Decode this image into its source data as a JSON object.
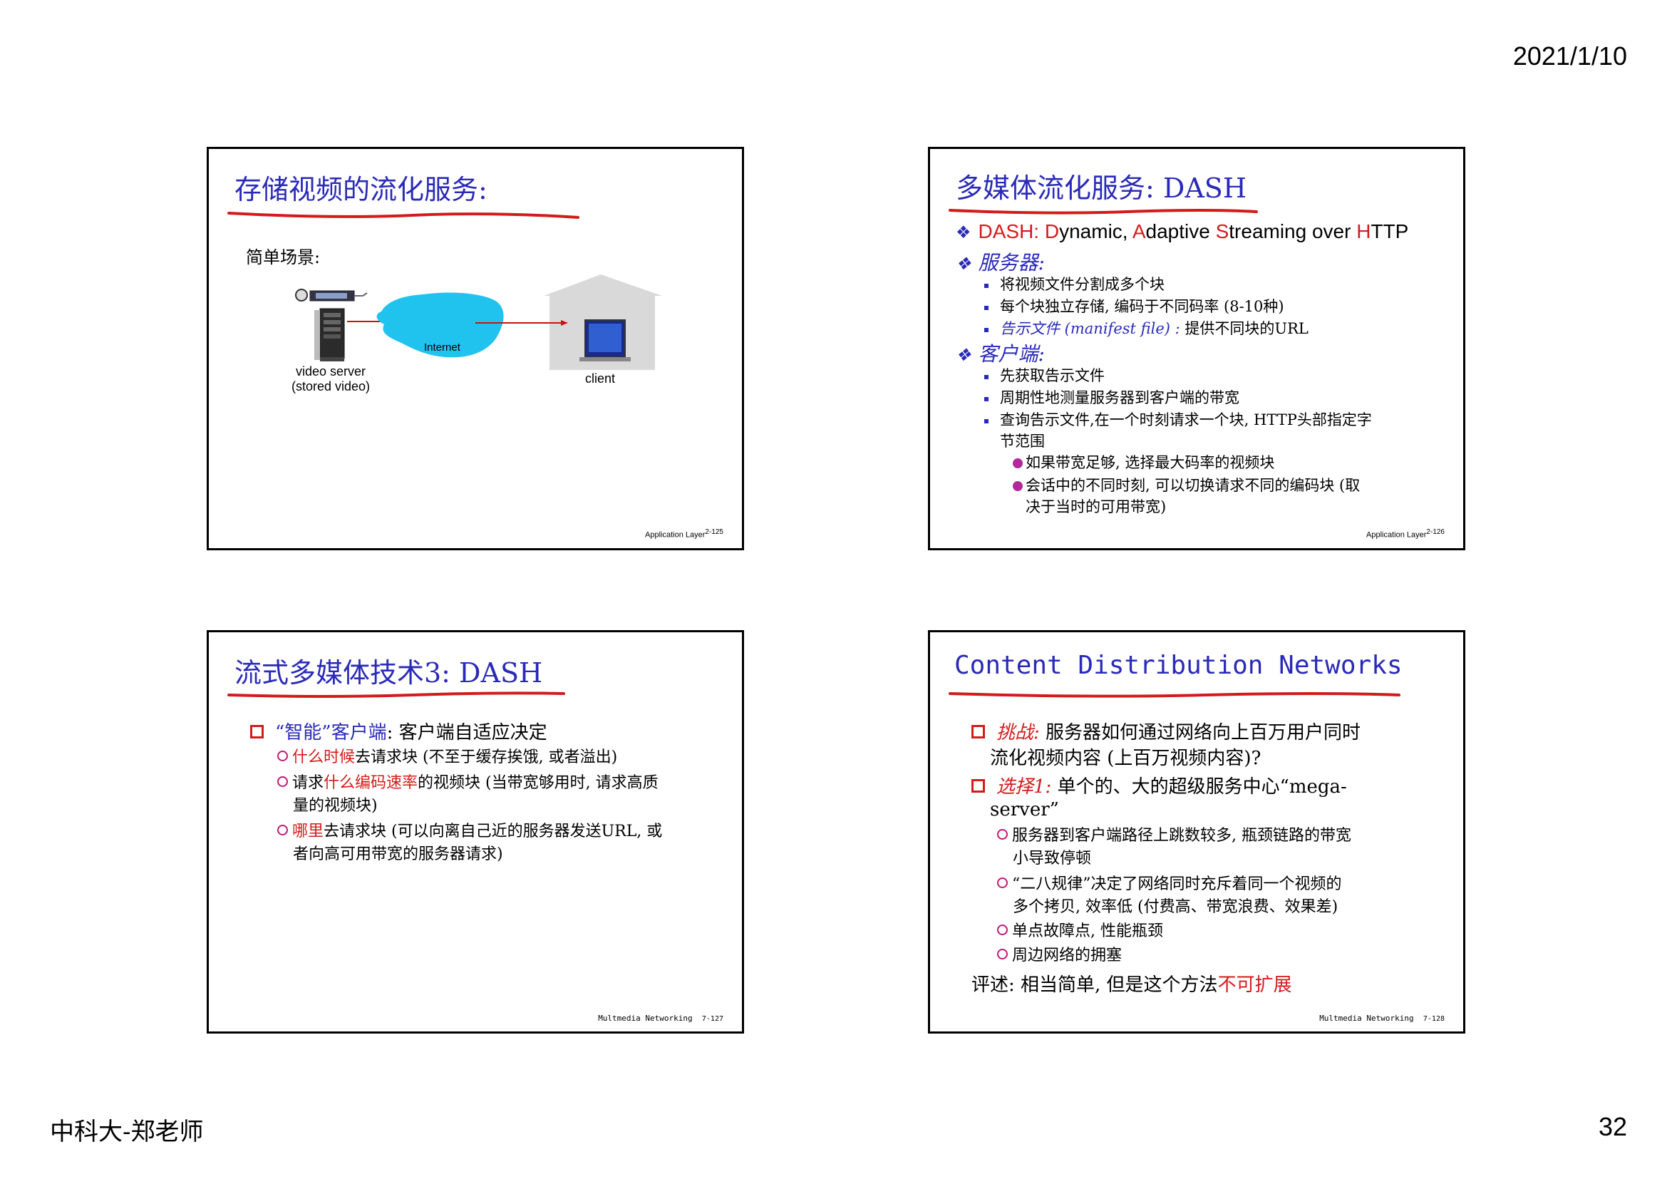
{
  "page": {
    "date": "2021/1/10",
    "footer_left": "中科大-郑老师",
    "page_number": "32"
  },
  "slides": [
    {
      "title": "存储视频的流化服务:",
      "scene_label": "简单场景:",
      "internet_label": "Internet",
      "server_label_1": "video server",
      "server_label_2": "(stored video)",
      "client_label": "client",
      "footer_text": "Application Layer",
      "footer_num": "2-125"
    },
    {
      "title": "多媒体流化服务: DASH",
      "dash_line": {
        "prefix": "DASH: ",
        "d": "D",
        "d_rest": "ynamic, ",
        "a": "A",
        "a_rest": "daptive ",
        "s": "S",
        "s_rest": "treaming over ",
        "h": "H",
        "h_rest": "TTP"
      },
      "server_head": "服务器:",
      "server_items": [
        "将视频文件分割成多个块",
        "每个块独立存储, 编码于不同码率 (8-10种)"
      ],
      "manifest_label": "告示文件 (manifest file) :",
      "manifest_text": " 提供不同块的URL",
      "client_head": "客户端:",
      "client_items": [
        "先获取告示文件",
        "周期性地测量服务器到客户端的带宽"
      ],
      "client_item3_line1": "查询告示文件,在一个时刻请求一个块, HTTP头部指定字",
      "client_item3_line2": "节范围",
      "sub_items": [
        "如果带宽足够, 选择最大码率的视频块",
        "会话中的不同时刻, 可以切换请求不同的编码块 (取"
      ],
      "sub_item2_line2": "决于当时的可用带宽)",
      "footer_text": "Application Layer",
      "footer_num": "2-126"
    },
    {
      "title": "流式多媒体技术3: DASH",
      "main_pre": "“智能”客户端",
      "main_post": ": 客户端自适应决定",
      "item1_red": "什么时候",
      "item1_rest": "去请求块 (不至于缓存挨饿, 或者溢出)",
      "item2_pre": "请求",
      "item2_red": "什么编码速率",
      "item2_rest": "的视频块 (当带宽够用时, 请求高质",
      "item2_line2": "量的视频块)",
      "item3_red": "哪里",
      "item3_rest": "去请求块 (可以向离自己近的服务器发送URL, 或",
      "item3_line2": "者向高可用带宽的服务器请求)",
      "footer_text": "Multmedia Networking",
      "footer_num": "7-127"
    },
    {
      "title": "Content Distribution Networks",
      "challenge_label": "挑战:",
      "challenge_text": " 服务器如何通过网络向上百万用户同时",
      "challenge_line2": "流化视频内容 (上百万视频内容)?",
      "option_label": "选择1:",
      "option_text": " 单个的、大的超级服务中心“mega-",
      "option_line2": "server”",
      "items": [
        [
          "服务器到客户端路径上跳数较多, 瓶颈链路的带宽",
          "小导致停顿"
        ],
        [
          "“二八规律”决定了网络同时充斥着同一个视频的",
          "多个拷贝, 效率低 (付费高、带宽浪费、效果差)"
        ],
        [
          "单点故障点, 性能瓶颈"
        ],
        [
          "周边网络的拥塞"
        ]
      ],
      "summary_pre": "评述: 相当简单, 但是这个方法",
      "summary_red": "不可扩展",
      "footer_text": "Multmedia Networking",
      "footer_num": "7-128"
    }
  ],
  "colors": {
    "title_blue": "#2a2ab8",
    "emphasis_red": "#d31b1b",
    "cloud_cyan": "#1fc3ee",
    "house_gray": "#d9d9d9",
    "bullet_magenta": "#c2187a"
  }
}
